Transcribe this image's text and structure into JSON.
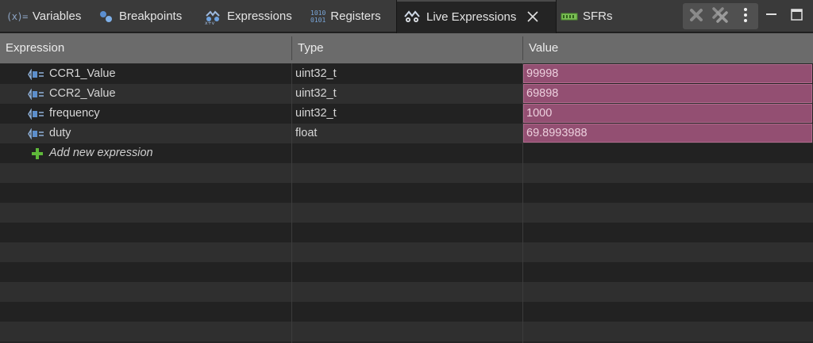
{
  "tabs": [
    {
      "label": "Variables",
      "icon": "variables-icon"
    },
    {
      "label": "Breakpoints",
      "icon": "breakpoints-icon"
    },
    {
      "label": "Expressions",
      "icon": "expressions-icon"
    },
    {
      "label": "Registers",
      "icon": "registers-icon"
    },
    {
      "label": "Live Expressions",
      "icon": "live-expressions-icon",
      "active": true
    },
    {
      "label": "SFRs",
      "icon": "sfrs-icon"
    }
  ],
  "variables_icon_text": "(x)=",
  "registers_icon_text": [
    "1010",
    "0101"
  ],
  "table": {
    "headers": {
      "expression": "Expression",
      "type": "Type",
      "value": "Value"
    },
    "rows": [
      {
        "expression": "CCR1_Value",
        "type": "uint32_t",
        "value": "99998"
      },
      {
        "expression": "CCR2_Value",
        "type": "uint32_t",
        "value": "69898"
      },
      {
        "expression": "frequency",
        "type": "uint32_t",
        "value": "1000"
      },
      {
        "expression": "duty",
        "type": "float",
        "value": "69.8993988"
      }
    ],
    "add_new_label": "Add new expression"
  },
  "colors": {
    "changed_value_bg": "#934f72",
    "header_bg": "#6b6b6b",
    "add_icon": "#5fb83a"
  }
}
